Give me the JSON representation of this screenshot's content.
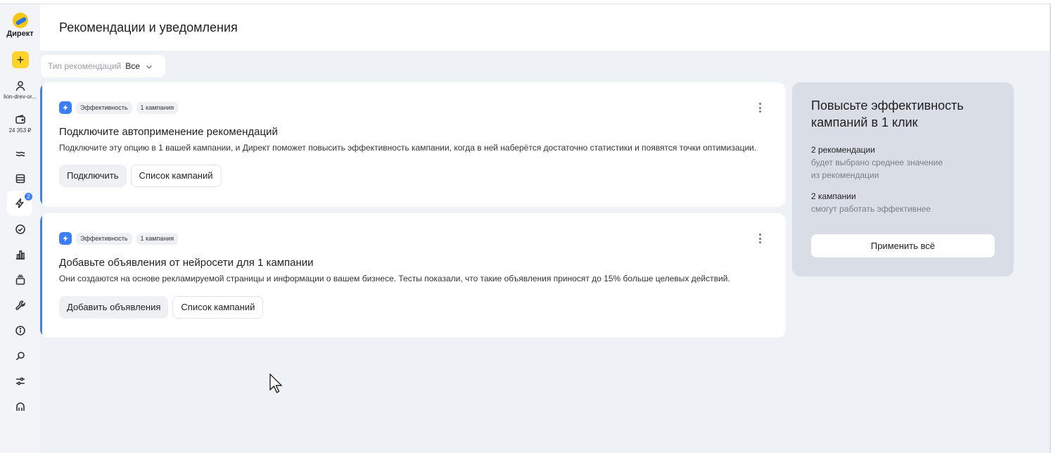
{
  "app": {
    "logo_text": "Директ"
  },
  "sidebar": {
    "account_name": "lion-drev-or...",
    "balance": "24 353 ₽",
    "recommendations_badge": "2"
  },
  "header": {
    "title": "Рекомендации и уведомления"
  },
  "filter": {
    "label": "Тип рекомендаций",
    "value": "Все"
  },
  "cards": [
    {
      "tag_category": "Эффективность",
      "tag_count": "1 кампания",
      "title": "Подключите автоприменение рекомендаций",
      "description": "Подключите эту опцию в 1 вашей кампании, и Директ поможет повысить эффективность кампании, когда в ней наберётся достаточно статистики и появятся точки оптимизации.",
      "primary_button": "Подключить",
      "secondary_button": "Список кампаний"
    },
    {
      "tag_category": "Эффективность",
      "tag_count": "1 кампания",
      "title": "Добавьте объявления от нейросети для 1 кампании",
      "description": "Они создаются на основе рекламируемой страницы и информации о вашем бизнесе. Тесты показали, что такие объявления приносят до 15% больше целевых действий.",
      "primary_button": "Добавить объявления",
      "secondary_button": "Список кампаний"
    }
  ],
  "promo": {
    "title": "Повысьте эффективность кампаний в 1 клик",
    "stat1_head": "2 рекомендации",
    "stat1_line1": "будет выбрано среднее значение",
    "stat1_line2": "из рекомендации",
    "stat2_head": "2 кампании",
    "stat2_line1": "смогут работать эффективнее",
    "apply_button": "Применить всё"
  },
  "colors": {
    "accent": "#3d7ef2",
    "create_button": "#fed42b",
    "promo_bg": "#d9dde5",
    "page_bg": "#eef1f6"
  },
  "icons": [
    "user-icon",
    "wallet-icon",
    "wave-icon",
    "campaigns-icon",
    "bolt-icon",
    "check-circle-icon",
    "chart-icon",
    "layers-icon",
    "wrench-icon",
    "info-icon",
    "search-icon",
    "sliders-icon",
    "headset-icon"
  ]
}
